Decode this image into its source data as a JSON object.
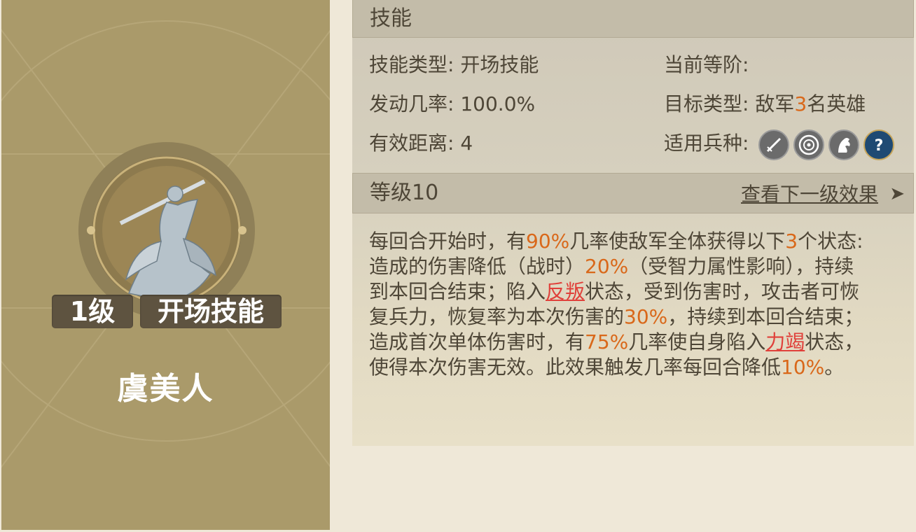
{
  "hero": {
    "level_badge": "1级",
    "skill_type_badge": "开场技能",
    "name": "虞美人"
  },
  "skill_header": "技能",
  "info": {
    "skill_type_label": "技能类型:",
    "skill_type_value": "开场技能",
    "current_rank_label": "当前等阶:",
    "current_rank_value": "",
    "trigger_rate_label": "发动几率:",
    "trigger_rate_value": "100.0%",
    "target_label": "目标类型:",
    "target_pre": "敌军",
    "target_num": "3",
    "target_post": "名英雄",
    "range_label": "有效距离:",
    "range_value": "4",
    "troop_label": "适用兵种:"
  },
  "troop_icons": [
    "sword-icon",
    "target-icon",
    "horse-icon",
    "question-icon"
  ],
  "level_header": "等级10",
  "next_level_link": "查看下一级效果",
  "description": [
    [
      [
        "每回合开始时，有",
        ""
      ],
      [
        "90%",
        "hl"
      ],
      [
        "几率使敌军全体获得以下",
        ""
      ],
      [
        "3",
        "hl"
      ],
      [
        "个状态:",
        ""
      ]
    ],
    [
      [
        "造成的伤害降低（战时）",
        ""
      ],
      [
        "20%",
        "hl"
      ],
      [
        "（受智力属性影响），持续",
        ""
      ]
    ],
    [
      [
        "到本回合结束；陷入",
        ""
      ],
      [
        "反叛",
        "red"
      ],
      [
        "状态，受到伤害时，攻击者可恢",
        ""
      ]
    ],
    [
      [
        "复兵力，恢复率为本次伤害的",
        ""
      ],
      [
        "30%",
        "hl"
      ],
      [
        "，持续到本回合结束；",
        ""
      ]
    ],
    [
      [
        "造成首次单体伤害时，有",
        ""
      ],
      [
        "75%",
        "hl"
      ],
      [
        "几率使自身陷入",
        ""
      ],
      [
        "力竭",
        "red"
      ],
      [
        "状态，",
        ""
      ]
    ],
    [
      [
        "使得本次伤害无效。此效果触发几率每回合降低",
        ""
      ],
      [
        "10%",
        "hl"
      ],
      [
        "。",
        ""
      ]
    ]
  ],
  "colors": {
    "highlight": "#d9681a",
    "status_red": "#e0403a",
    "card_bg": "#aa9a6a",
    "text": "#4e4637"
  }
}
